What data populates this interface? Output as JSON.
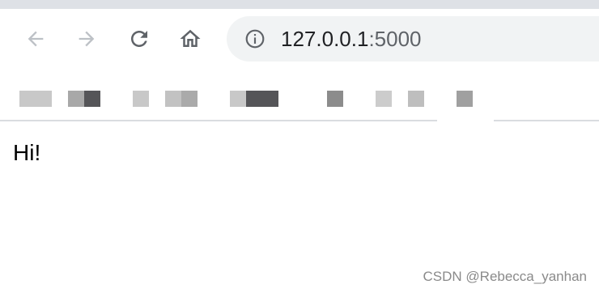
{
  "browser": {
    "nav": {
      "back": "back-arrow-icon",
      "forward": "forward-arrow-icon",
      "reload": "reload-icon",
      "home": "home-icon"
    },
    "address_bar": {
      "site_info_icon": "info-icon",
      "url_host": "127.0.0.1",
      "url_port": ":5000"
    },
    "bookmarks_note": "",
    "colors": {
      "top_strip": "#dee1e6",
      "omnibox_bg": "#f1f3f4",
      "icon_disabled": "#bdc1c6",
      "icon_enabled": "#5f6368",
      "url_text": "#202124"
    }
  },
  "page": {
    "text": "Hi!"
  },
  "watermark": {
    "text": "CSDN @Rebecca_yanhan"
  }
}
